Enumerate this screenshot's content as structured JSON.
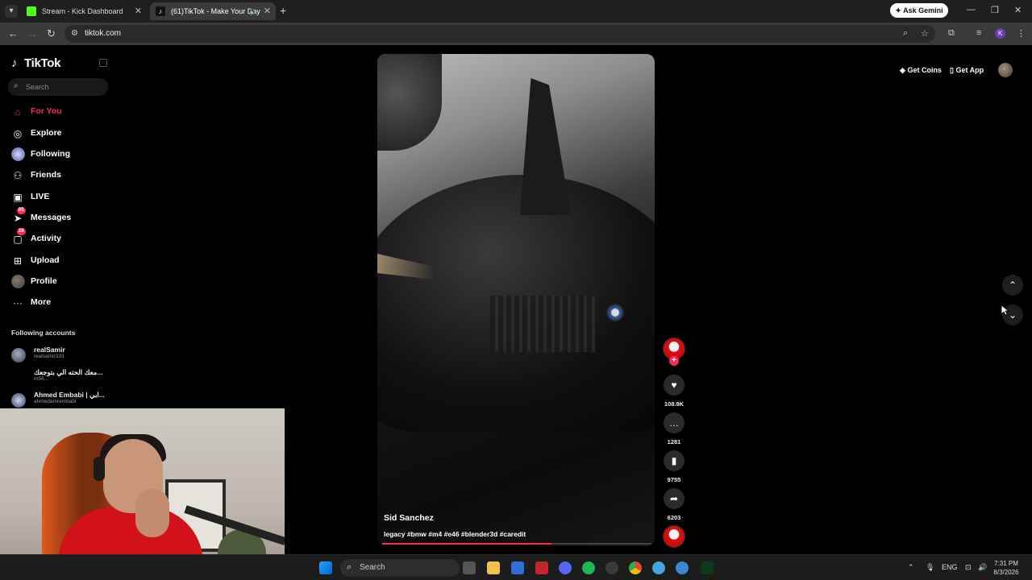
{
  "browser": {
    "tabs": [
      {
        "title": "Stream - Kick Dashboard",
        "favicon_color": "#53fc18"
      },
      {
        "title": "(61)TikTok - Make Your Day"
      }
    ],
    "gemini_label": "Ask Gemini",
    "url": "tiktok.com",
    "profile_initial": "K"
  },
  "sidebar": {
    "logo": "TikTok",
    "search_placeholder": "Search",
    "nav": [
      {
        "label": "For You",
        "icon": "home-icon",
        "active": true
      },
      {
        "label": "Explore",
        "icon": "compass-icon"
      },
      {
        "label": "Following",
        "icon": "following-avatar-icon"
      },
      {
        "label": "Friends",
        "icon": "friends-icon"
      },
      {
        "label": "LIVE",
        "icon": "live-icon"
      },
      {
        "label": "Messages",
        "icon": "messages-icon",
        "badge": "65"
      },
      {
        "label": "Activity",
        "icon": "activity-icon",
        "badge": "16"
      },
      {
        "label": "Upload",
        "icon": "upload-icon"
      },
      {
        "label": "Profile",
        "icon": "profile-avatar-icon"
      },
      {
        "label": "More",
        "icon": "more-icon"
      }
    ],
    "following_title": "Following accounts",
    "following": [
      {
        "name": "realSamir",
        "handle": "realsamir333"
      },
      {
        "name": "معك الحته الي بتوجعك...",
        "handle": "m56..."
      },
      {
        "name": "Ahmed Embabi | ابي...",
        "handle": "ahmedamrembabi"
      }
    ]
  },
  "video": {
    "author": "Sid Sanchez",
    "caption": "legacy #bmw #m4 #e46 #blender3d #caredit",
    "progress": 0.63
  },
  "actions": {
    "likes": "108.9K",
    "comments": "1281",
    "saves": "9755",
    "shares": "6203"
  },
  "topright": {
    "get_coins": "Get Coins",
    "get_app": "Get App"
  },
  "taskbar": {
    "search_label": "Search",
    "lang": "ENG",
    "time": "7:31 PM",
    "date": "8/3/2026"
  },
  "colors": {
    "accent": "#fe2c55",
    "background": "#000000"
  }
}
